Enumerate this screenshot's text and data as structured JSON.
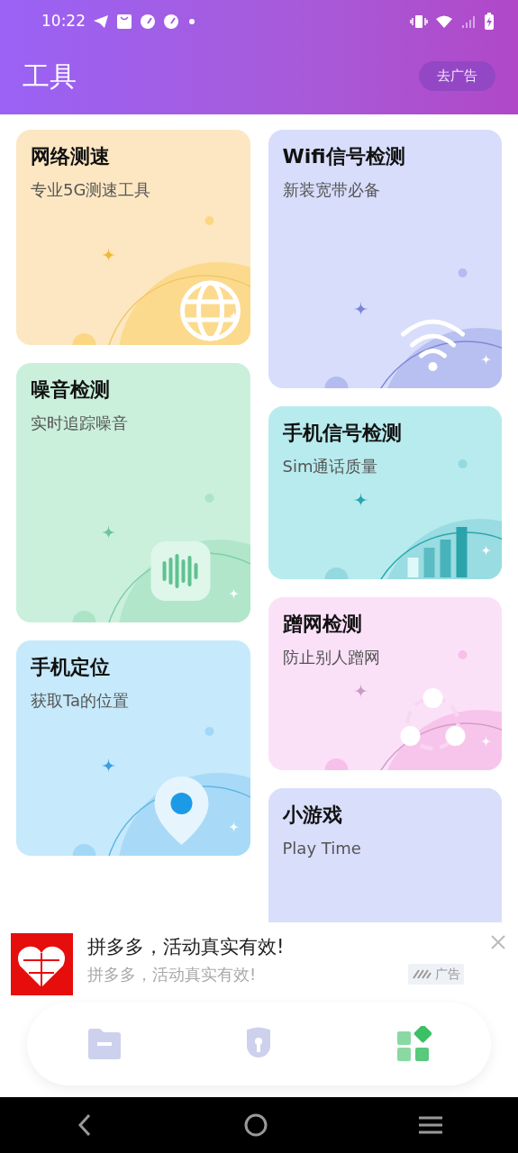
{
  "status_bar": {
    "time": "10:22"
  },
  "app_bar": {
    "title": "工具",
    "button": "去广告"
  },
  "left_column": [
    {
      "title": "网络测速",
      "subtitle": "专业5G测速工具",
      "kind": "globe",
      "color": "#fde7c2"
    },
    {
      "title": "噪音检测",
      "subtitle": "实时追踪噪音",
      "kind": "sound",
      "color": "#caf0dc"
    },
    {
      "title": "手机定位",
      "subtitle": "获取Ta的位置",
      "kind": "location",
      "color": "#c6e9fb"
    }
  ],
  "right_column": [
    {
      "title": "Wifi信号检测",
      "subtitle": "新装宽带必备",
      "kind": "wifi",
      "color": "#d8ddfb"
    },
    {
      "title": "手机信号检测",
      "subtitle": "Sim通话质量",
      "kind": "signal",
      "color": "#b8ebee"
    },
    {
      "title": "蹭网检测",
      "subtitle": "防止别人蹭网",
      "kind": "share",
      "color": "#fbe1f8"
    },
    {
      "title": "小游戏",
      "subtitle": "Play Time",
      "kind": "none",
      "color": "#d9defb"
    }
  ],
  "ad": {
    "title": "拼多多，活动真实有效!",
    "subtitle": "拼多多，活动真实有效!",
    "badge": "广告"
  },
  "tabs": [
    {
      "kind": "folder",
      "selected": false
    },
    {
      "kind": "lock",
      "selected": false
    },
    {
      "kind": "apps",
      "selected": true
    }
  ]
}
